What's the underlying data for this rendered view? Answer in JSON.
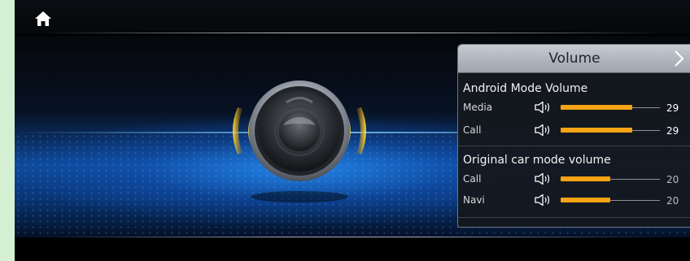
{
  "panel": {
    "title": "Volume",
    "sections": [
      {
        "title": "Android Mode Volume",
        "rows": [
          {
            "label": "Media",
            "value": "29",
            "level": 0.725,
            "value_color": "#ffffff"
          },
          {
            "label": "Call",
            "value": "29",
            "level": 0.725,
            "value_color": "#ffffff"
          }
        ]
      },
      {
        "title": "Original car mode volume",
        "rows": [
          {
            "label": "Call",
            "value": "20",
            "level": 0.5,
            "value_color": "#b9bcc2"
          },
          {
            "label": "Navi",
            "value": "20",
            "level": 0.5,
            "value_color": "#b9bcc2"
          }
        ]
      }
    ]
  },
  "icons": {
    "home": "home-icon",
    "next": "chevron-right-icon",
    "speaker": "speaker-icon",
    "volume": "speaker-volume-icon"
  },
  "colors": {
    "accent": "#f6a315",
    "glow": "#f2b600",
    "stage_blue": "#0e4a9a"
  }
}
